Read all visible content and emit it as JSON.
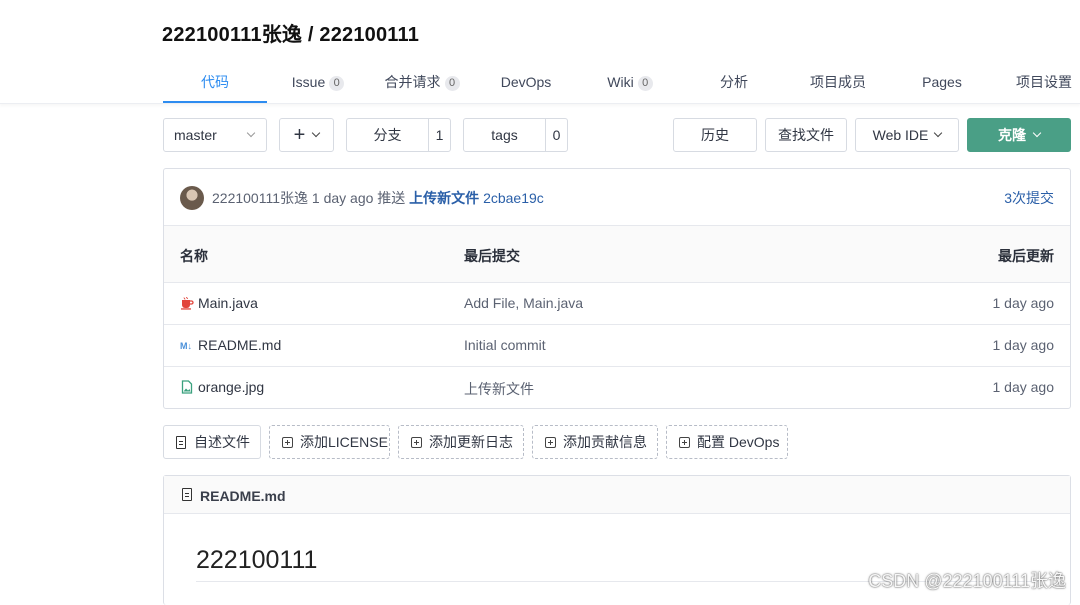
{
  "repo_title": "222100111张逸 / 222100111",
  "tabs": [
    {
      "label": "代码",
      "count": null
    },
    {
      "label": "Issue",
      "count": "0"
    },
    {
      "label": "合并请求",
      "count": "0"
    },
    {
      "label": "DevOps",
      "count": null
    },
    {
      "label": "Wiki",
      "count": "0"
    },
    {
      "label": "分析",
      "count": null
    },
    {
      "label": "项目成员",
      "count": null
    },
    {
      "label": "Pages",
      "count": null
    },
    {
      "label": "项目设置",
      "count": null
    }
  ],
  "toolbar": {
    "branch": "master",
    "add": "+",
    "branches_label": "分支",
    "branches_count": "1",
    "tags_label": "tags",
    "tags_count": "0",
    "history": "历史",
    "find_file": "查找文件",
    "web_ide": "Web IDE",
    "clone": "克隆"
  },
  "commit": {
    "author": "222100111张逸",
    "time": "1 day ago",
    "action": "推送",
    "message": "上传新文件",
    "sha": "2cbae19c",
    "count_link": "3次提交"
  },
  "table": {
    "headers": [
      "名称",
      "最后提交",
      "最后更新"
    ],
    "rows": [
      {
        "icon": "java-file-icon",
        "name": "Main.java",
        "commit": "Add File, Main.java",
        "updated": "1 day ago"
      },
      {
        "icon": "markdown-file-icon",
        "name": "README.md",
        "commit": "Initial commit",
        "updated": "1 day ago"
      },
      {
        "icon": "image-file-icon",
        "name": "orange.jpg",
        "commit": "上传新文件",
        "updated": "1 day ago"
      }
    ]
  },
  "actions": [
    "自述文件",
    "添加LICENSE",
    "添加更新日志",
    "添加贡献信息",
    "配置 DevOps"
  ],
  "readme": {
    "filename": "README.md",
    "heading": "222100111"
  },
  "watermark": "CSDN @222100111张逸",
  "colors": {
    "accent": "#2d8cf0",
    "clone_button": "#4a9f86",
    "link": "#2a5fa8"
  }
}
